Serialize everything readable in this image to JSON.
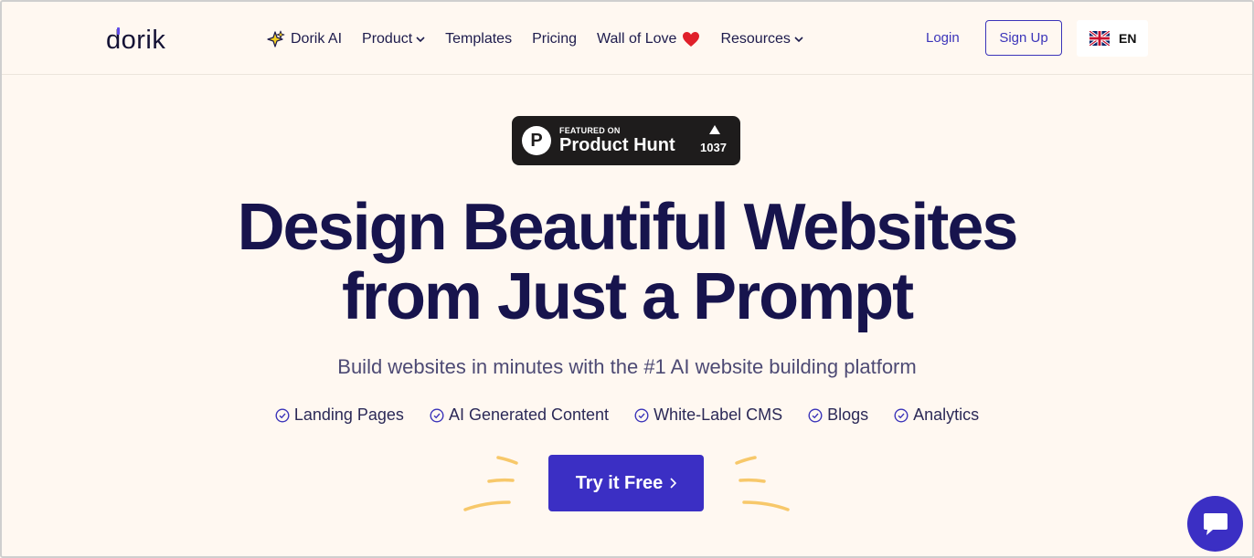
{
  "header": {
    "logo": "dorik",
    "nav": [
      {
        "label": "Dorik AI",
        "icon": "sparkle-icon"
      },
      {
        "label": "Product",
        "icon": "chevron-down-icon"
      },
      {
        "label": "Templates"
      },
      {
        "label": "Pricing"
      },
      {
        "label": "Wall of Love",
        "icon": "heart-icon"
      },
      {
        "label": "Resources",
        "icon": "chevron-down-icon"
      }
    ],
    "login_label": "Login",
    "signup_label": "Sign Up",
    "language": {
      "code": "EN",
      "icon": "uk-flag-icon"
    }
  },
  "badge": {
    "featured_label": "FEATURED ON",
    "name": "Product Hunt",
    "votes": "1037"
  },
  "hero": {
    "headline_line1": "Design Beautiful Websites",
    "headline_line2": "from Just a Prompt",
    "subheadline": "Build websites in minutes with the #1 AI website building platform",
    "features": [
      "Landing Pages",
      "AI Generated Content",
      "White-Label CMS",
      "Blogs",
      "Analytics"
    ],
    "cta_label": "Try it Free"
  },
  "colors": {
    "background": "#fff8f1",
    "primary": "#3b2fc4",
    "heading": "#17144d",
    "accent_deco": "#f7c86a"
  }
}
